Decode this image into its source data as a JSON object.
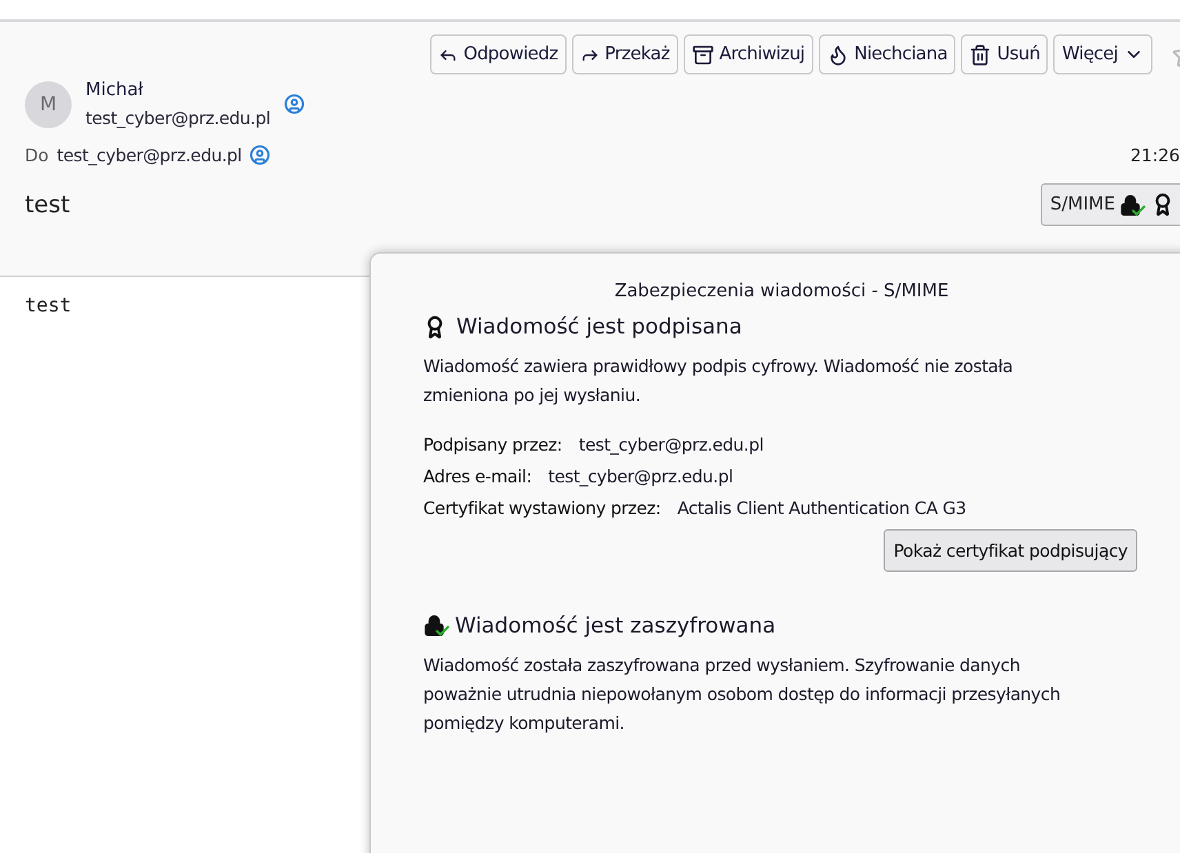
{
  "toolbar": [
    {
      "kind": "reply",
      "label": "Odpowiedz"
    },
    {
      "kind": "forward",
      "label": "Przekaż"
    },
    {
      "kind": "archive",
      "label": "Archiwizuj"
    },
    {
      "kind": "junk",
      "label": "Niechciana"
    },
    {
      "kind": "delete",
      "label": "Usuń"
    },
    {
      "kind": "more",
      "label": "Więcej"
    }
  ],
  "sender": {
    "avatar": "M",
    "name": "Michał",
    "email": "test_cyber@prz.edu.pl"
  },
  "recipients": {
    "label": "Do",
    "email": "test_cyber@prz.edu.pl"
  },
  "time": "21:26",
  "subject": "test",
  "security_button": {
    "label": "S/MIME",
    "encrypted": true,
    "signed": true
  },
  "body": "test",
  "popup": {
    "title": "Zabezpieczenia wiadomości - S/MIME",
    "sections": [
      {
        "kind": "signed",
        "heading": "Wiadomość jest podpisana",
        "text": "Wiadomość zawiera prawidłowy podpis cyfrowy. Wiadomość nie została zmieniona po jej wysłaniu.",
        "fields": [
          {
            "label": "Podpisany przez:",
            "value": "test_cyber@prz.edu.pl"
          },
          {
            "label": "Adres e-mail:",
            "value": "test_cyber@prz.edu.pl"
          },
          {
            "label": "Certyfikat wystawiony przez:",
            "value": "Actalis Client Authentication CA G3"
          }
        ],
        "button": "Pokaż certyfikat podpisujący"
      },
      {
        "kind": "encrypted",
        "heading": "Wiadomość jest zaszyfrowana",
        "text": "Wiadomość została zaszyfrowana przed wysłaniem. Szyfrowanie danych poważnie utrudnia niepowołanym osobom dostęp do informacji przesyłanych pomiędzy komputerami."
      }
    ]
  }
}
